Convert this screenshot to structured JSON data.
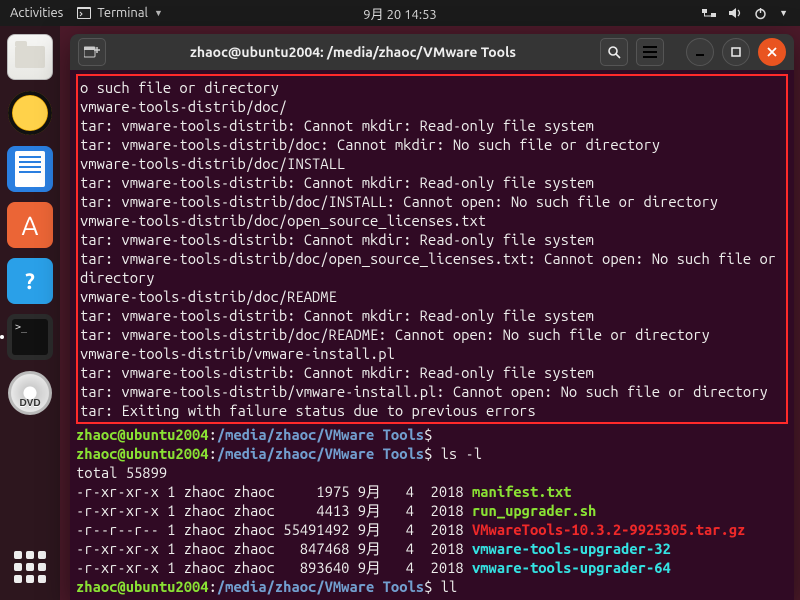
{
  "panel": {
    "activities": "Activities",
    "app_name": "Terminal",
    "clock": "9月 20  14:53"
  },
  "window": {
    "title": "zhaoc@ubuntu2004: /media/zhaoc/VMware Tools"
  },
  "prompt": {
    "user_host": "zhaoc@ubuntu2004",
    "path": "/media/zhaoc/VMware Tools",
    "cmd_ls": "ls -l",
    "cmd_ll": "ll"
  },
  "error_lines": [
    "o such file or directory",
    "vmware-tools-distrib/doc/",
    "tar: vmware-tools-distrib: Cannot mkdir: Read-only file system",
    "tar: vmware-tools-distrib/doc: Cannot mkdir: No such file or directory",
    "vmware-tools-distrib/doc/INSTALL",
    "tar: vmware-tools-distrib: Cannot mkdir: Read-only file system",
    "tar: vmware-tools-distrib/doc/INSTALL: Cannot open: No such file or directory",
    "vmware-tools-distrib/doc/open_source_licenses.txt",
    "tar: vmware-tools-distrib: Cannot mkdir: Read-only file system",
    "tar: vmware-tools-distrib/doc/open_source_licenses.txt: Cannot open: No such file or directory",
    "vmware-tools-distrib/doc/README",
    "tar: vmware-tools-distrib: Cannot mkdir: Read-only file system",
    "tar: vmware-tools-distrib/doc/README: Cannot open: No such file or directory",
    "vmware-tools-distrib/vmware-install.pl",
    "tar: vmware-tools-distrib: Cannot mkdir: Read-only file system",
    "tar: vmware-tools-distrib/vmware-install.pl: Cannot open: No such file or directory",
    "tar: Exiting with failure status due to previous errors"
  ],
  "ls": {
    "total": "total 55899",
    "rows": [
      {
        "perm": "-r-xr-xr-x",
        "links": "1",
        "owner": "zhaoc",
        "group": "zhaoc",
        "size": "1975",
        "date": "9月   4  2018",
        "name": "manifest.txt",
        "cls": "f-green"
      },
      {
        "perm": "-r-xr-xr-x",
        "links": "1",
        "owner": "zhaoc",
        "group": "zhaoc",
        "size": "4413",
        "date": "9月   4  2018",
        "name": "run_upgrader.sh",
        "cls": "f-green"
      },
      {
        "perm": "-r--r--r--",
        "links": "1",
        "owner": "zhaoc",
        "group": "zhaoc",
        "size": "55491492",
        "date": "9月   4  2018",
        "name": "VMwareTools-10.3.2-9925305.tar.gz",
        "cls": "f-red"
      },
      {
        "perm": "-r-xr-xr-x",
        "links": "1",
        "owner": "zhaoc",
        "group": "zhaoc",
        "size": "847468",
        "date": "9月   4  2018",
        "name": "vmware-tools-upgrader-32",
        "cls": "f-cyan"
      },
      {
        "perm": "-r-xr-xr-x",
        "links": "1",
        "owner": "zhaoc",
        "group": "zhaoc",
        "size": "893640",
        "date": "9月   4  2018",
        "name": "vmware-tools-upgrader-64",
        "cls": "f-cyan"
      }
    ]
  }
}
